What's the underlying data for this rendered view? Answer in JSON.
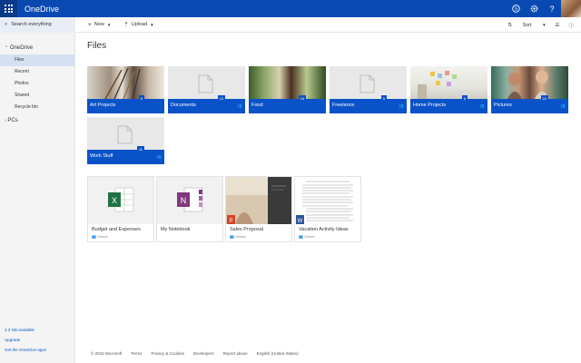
{
  "app": {
    "title": "OneDrive"
  },
  "commands": {
    "search_placeholder": "Search everything",
    "new": "New",
    "upload": "Upload",
    "sort": "Sort"
  },
  "sidebar": {
    "heading": "OneDrive",
    "items": [
      "Files",
      "Recent",
      "Photos",
      "Shared",
      "Recycle bin"
    ],
    "pcs": "PCs",
    "storage": "4.2 GB available",
    "upgrade": "Upgrade",
    "get_apps": "Get the OneDrive apps"
  },
  "main": {
    "title": "Files",
    "folders": [
      {
        "name": "Art Projects",
        "count": "9",
        "shared": false
      },
      {
        "name": "Documents",
        "count": "10",
        "shared": true
      },
      {
        "name": "Food",
        "count": "16",
        "shared": false
      },
      {
        "name": "Freelance",
        "count": "5",
        "shared": true
      },
      {
        "name": "Home Projects",
        "count": "8",
        "shared": true
      },
      {
        "name": "Pictures",
        "count": "22",
        "shared": true
      },
      {
        "name": "Work Stuff",
        "count": "11",
        "shared": true
      }
    ],
    "files": [
      {
        "name": "Budget and Expenses",
        "owner": "Owner"
      },
      {
        "name": "My Notebook",
        "owner": ""
      },
      {
        "name": "Sales Proposal",
        "owner": "Owner"
      },
      {
        "name": "Vacation Activity Ideas",
        "owner": "Owner"
      }
    ]
  },
  "footer": [
    "© 2016 Microsoft",
    "Terms",
    "Privacy & Cookies",
    "Developers",
    "Report abuse",
    "English (United States)"
  ],
  "colors": {
    "brand": "#094ab2",
    "tile_bar": "#0a52c8",
    "sidebar": "#f4f4f4",
    "selected": "#d5e1f2"
  }
}
